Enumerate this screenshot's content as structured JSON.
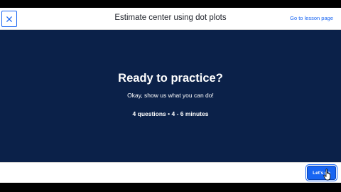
{
  "header": {
    "close_icon": "close-icon",
    "title": "Estimate center using dot plots",
    "lesson_link": "Go to lesson page"
  },
  "main": {
    "heading": "Ready to practice?",
    "subtext": "Okay, show us what you can do!",
    "meta": "4 questions • 4 - 6 minutes"
  },
  "footer": {
    "go_button_label": "Let's go"
  },
  "colors": {
    "brand_blue": "#1865f2",
    "panel_navy": "#0b2149",
    "text_dark": "#21242c"
  },
  "icons": {
    "close": "close-icon",
    "pointer": "hand-pointer-icon"
  }
}
